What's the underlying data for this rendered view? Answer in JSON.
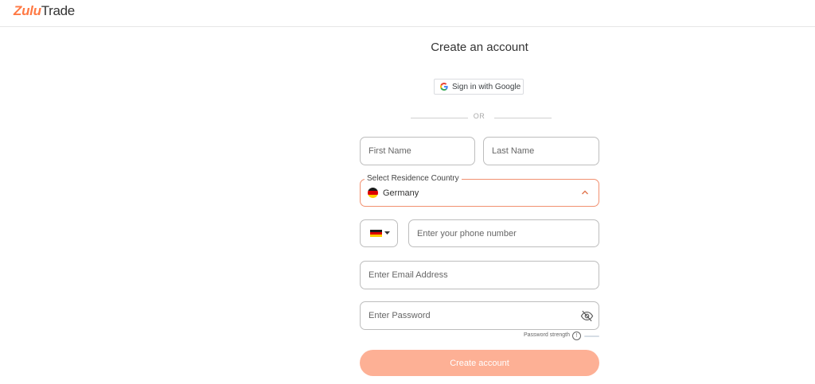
{
  "header": {
    "logo_zulu": "Zulu",
    "logo_trade": "Trade"
  },
  "page": {
    "title": "Create an account"
  },
  "google": {
    "label": "Sign in with Google",
    "icon": "google-icon"
  },
  "divider": {
    "text": "OR"
  },
  "form": {
    "first_name_placeholder": "First Name",
    "last_name_placeholder": "Last Name",
    "country_label": "Select Residence Country",
    "country_value": "Germany",
    "phone_placeholder": "Enter your phone number",
    "email_placeholder": "Enter Email Address",
    "password_placeholder": "Enter Password",
    "password_strength_label": "Password strength",
    "submit_label": "Create account"
  },
  "colors": {
    "accent": "#ff7a45",
    "button_disabled": "#fdb095",
    "country_border": "#f19070"
  }
}
